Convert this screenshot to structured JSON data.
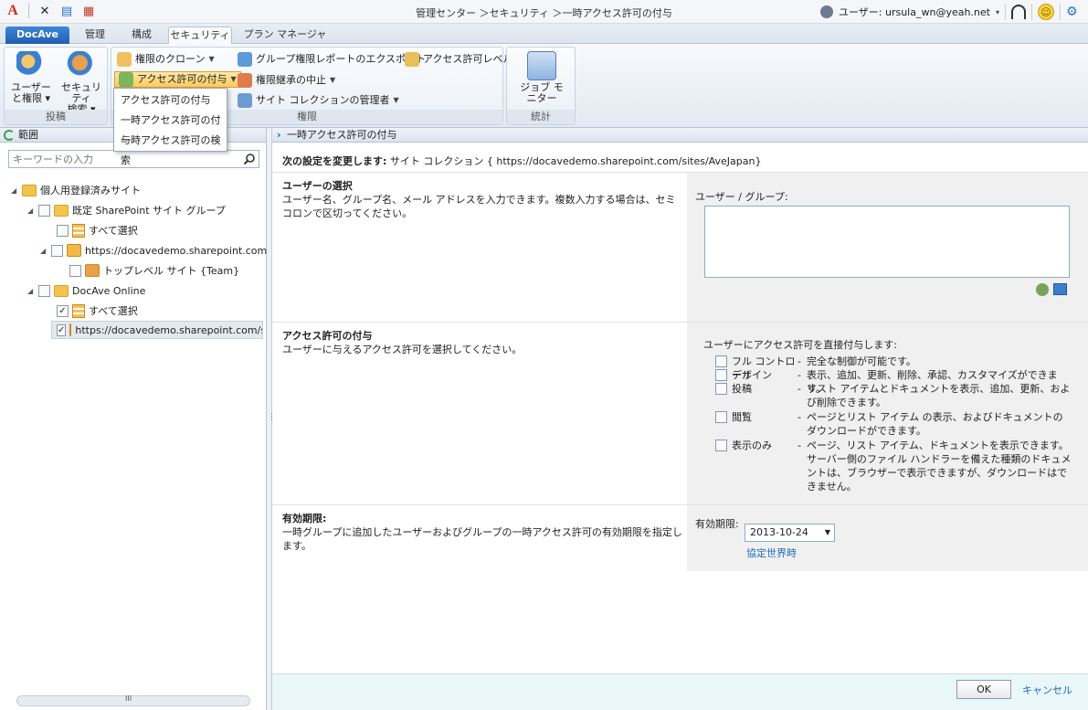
{
  "titlebar": {
    "title": "管理センター ＞セキュリティ ＞一時アクセス許可の付与",
    "user_label": "ユーザー: ursula_wn@yeah.net",
    "user_caret": "▾"
  },
  "tabs": [
    {
      "label": "DocAve"
    },
    {
      "label": "管理"
    },
    {
      "label": "構成"
    },
    {
      "label": "セキュリティ"
    },
    {
      "label": "プラン マネージャー"
    }
  ],
  "ribbon": {
    "group1": {
      "label": "投稿",
      "users_permissions": "ユーザー\nと権限 ▾",
      "security_search": "セキュリティ\n検索 ▾"
    },
    "group2": {
      "label": "権限",
      "clone": "権限のクローン",
      "grant": "アクセス許可の付与",
      "group_report": "グループ権限レポートのエクスポート",
      "access_level": "アクセス許可レベル",
      "stop_inherit": "権限継承の中止",
      "site_admins": "サイト コレクションの管理者"
    },
    "group3": {
      "label": "統計",
      "job_monitor": "ジョブ モニター"
    }
  },
  "dropdown": {
    "items": [
      "アクセス許可の付与",
      "一時アクセス許可の付与",
      "一時アクセス許可の検索"
    ]
  },
  "left": {
    "header": "範囲",
    "search_placeholder": "キーワードの入力",
    "tree": {
      "root": "個人用登録済みサイト",
      "default_group": "既定 SharePoint サイト グループ",
      "select_all_1": "すべて選択",
      "site1": "https://docavedemo.sharepoint.com",
      "toplevel": "トップレベル サイト {Team}",
      "docave_online": "DocAve Online",
      "select_all_2": "すべて選択",
      "site2": "https://docavedemo.sharepoint.com/site"
    },
    "scroll_grip": "III"
  },
  "main": {
    "header": "一時アクセス許可の付与",
    "change_label": "次の設定を変更します:",
    "change_value": "サイト コレクション { https://docavedemo.sharepoint.com/sites/AveJapan}",
    "user_select": {
      "title": "ユーザーの選択",
      "desc": "ユーザー名、グループ名、メール アドレスを入力できます。複数入力する場合は、セミコロンで区切ってください。",
      "field_label": "ユーザー / グループ:"
    },
    "grant": {
      "title": "アクセス許可の付与",
      "desc": "ユーザーに与えるアクセス許可を選択してください。",
      "field_label": "ユーザーにアクセス許可を直接付与します:",
      "perms": [
        {
          "name": "フル コントロール",
          "desc": "完全な制御が可能です。"
        },
        {
          "name": "デザイン",
          "desc": "表示、追加、更新、削除、承認、カスタマイズができます。"
        },
        {
          "name": "投稿",
          "desc": "リスト アイテムとドキュメントを表示、追加、更新、および削除できます。"
        },
        {
          "name": "閲覧",
          "desc": "ページとリスト アイテム の表示、およびドキュメントのダウンロードができます。"
        },
        {
          "name": "表示のみ",
          "desc": "ページ、リスト アイテム、ドキュメントを表示できます。サーバー側のファイル ハンドラーを備えた種類のドキュメントは、ブラウザーで表示できますが、ダウンロードはできません。"
        }
      ]
    },
    "expiry": {
      "title": "有効期限:",
      "desc": "一時グループに追加したユーザーおよびグループの一時アクセス許可の有効期限を指定します。",
      "field_label": "有効期限:",
      "date": "2013-10-24",
      "timezone": "協定世界時"
    }
  },
  "footer": {
    "ok": "OK",
    "cancel": "キャンセル"
  },
  "colors": {
    "accent": "#1f5fb0",
    "active_button": "#fbc95c",
    "link": "#1f6bbf"
  }
}
